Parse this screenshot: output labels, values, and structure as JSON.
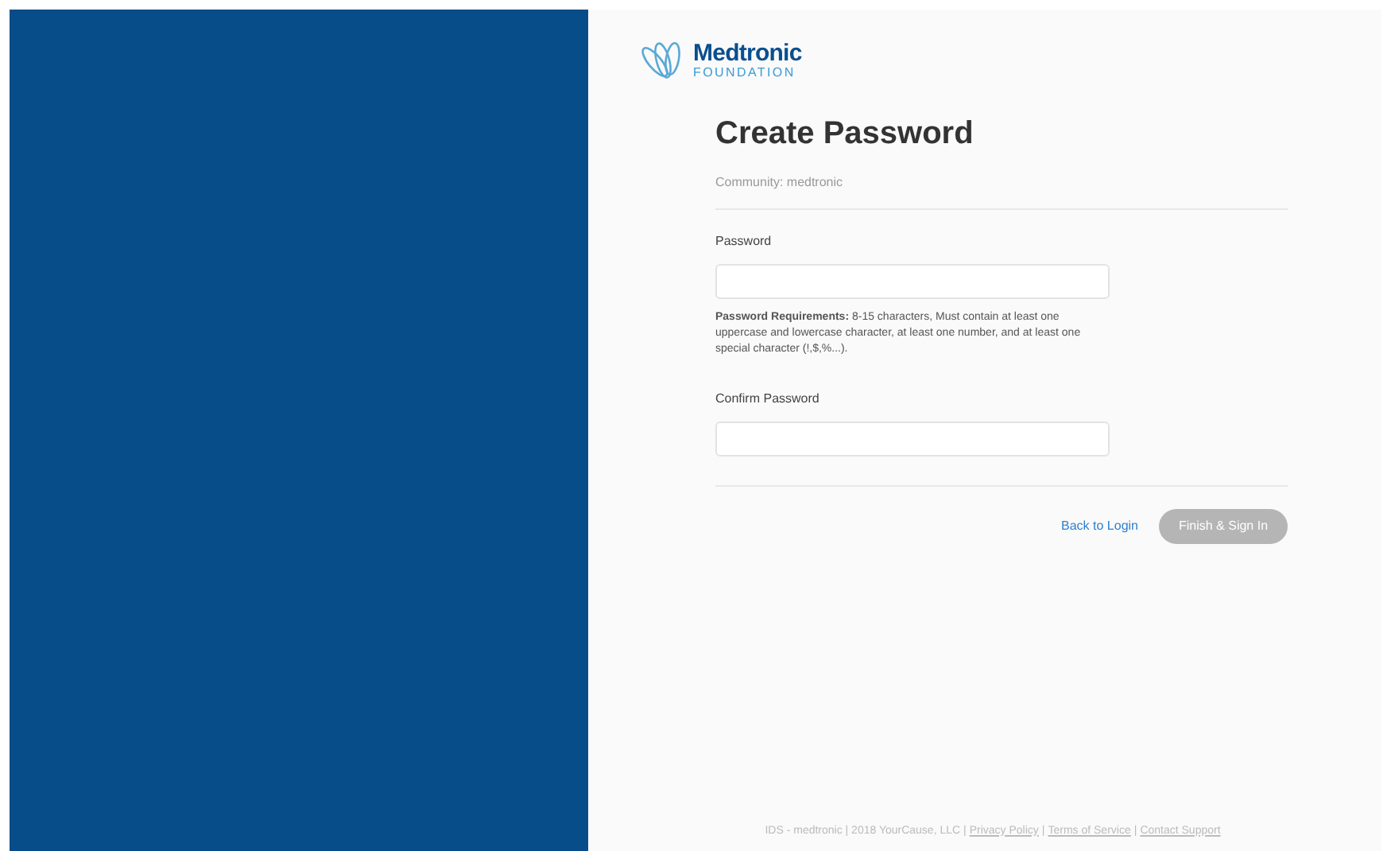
{
  "logo": {
    "name": "Medtronic",
    "subtitle": "FOUNDATION"
  },
  "title": "Create Password",
  "community": "Community: medtronic",
  "fields": [
    {
      "label": "Password"
    },
    {
      "label": "Confirm Password"
    }
  ],
  "requirements": "**Password Requirements:** 8-15 characters, Must contain at least one uppercase and lowercase character, at least one number, and at least one special character (!,$,%...).",
  "back_link": "Back to Login",
  "submit": {
    "label": "Finish & Sign In",
    "disabled": true
  },
  "footer": [
    {
      "kind": "text",
      "text": "IDS - medtronic | 2018 YourCause, LLC |"
    },
    {
      "kind": "link",
      "text": "Privacy Policy"
    },
    {
      "kind": "text",
      "text": "|"
    },
    {
      "kind": "link",
      "text": "Terms of Service"
    },
    {
      "kind": "text",
      "text": "|"
    },
    {
      "kind": "link",
      "text": "Contact Support"
    }
  ]
}
